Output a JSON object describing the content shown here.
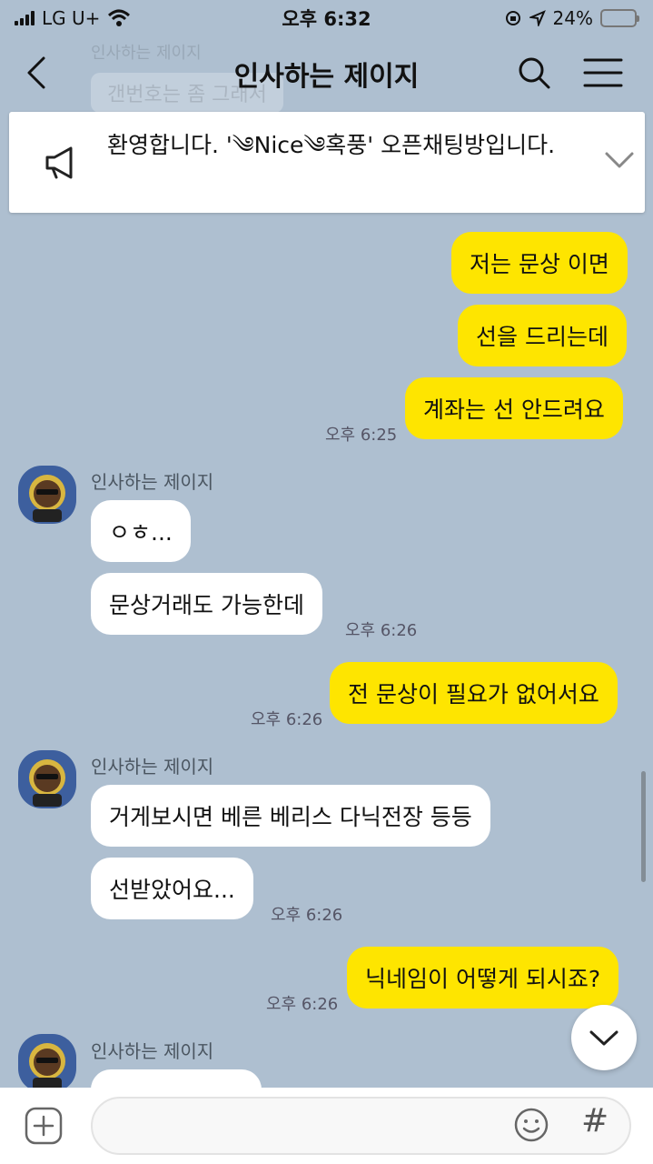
{
  "status_bar": {
    "carrier": "LG U+",
    "time": "오후 6:32",
    "battery": "24%",
    "battery_level": 0.24
  },
  "header": {
    "title": "인사하는 제이지",
    "icons": [
      "back-icon",
      "search-icon",
      "menu-icon"
    ]
  },
  "background_preview": {
    "sender": "인사하는 제이지",
    "text": "갠번호는 좀 그래서"
  },
  "notice": {
    "text": "환영합니다. '༄Nice༄혹풍' 오픈채팅방입니다.",
    "icons": [
      "megaphone-icon",
      "chevron-down-icon"
    ]
  },
  "messages": [
    {
      "from": "me",
      "text": "저는 문상 이면"
    },
    {
      "from": "me",
      "text": "선을 드리는데"
    },
    {
      "from": "me",
      "text": "계좌는 선 안드려요",
      "time": "오후 6:25"
    },
    {
      "from": "other",
      "sender": "인사하는 제이지",
      "text": "ㅇㅎ..."
    },
    {
      "from": "other",
      "text": "문상거래도 가능한데",
      "time": "오후 6:26"
    },
    {
      "from": "me",
      "text": "전 문상이 필요가 없어서요",
      "time": "오후 6:26"
    },
    {
      "from": "other",
      "sender": "인사하는 제이지",
      "text": "거게보시면 베른 베리스 다닉전장 등등"
    },
    {
      "from": "other",
      "text": "선받았어요...",
      "time": "오후 6:26"
    },
    {
      "from": "me",
      "text": "닉네임이 어떻게 되시죠?",
      "time": "오후 6:26"
    },
    {
      "from": "other",
      "sender": "인사하는 제이지",
      "text": ""
    }
  ],
  "input_bar": {
    "placeholder": "",
    "hash_label": "#",
    "icons": [
      "plus-icon",
      "emoji-icon"
    ]
  },
  "colors": {
    "background": "#aebfd0",
    "my_bubble": "#fee500",
    "other_bubble": "#ffffff",
    "avatar": "#3d5f9e"
  }
}
